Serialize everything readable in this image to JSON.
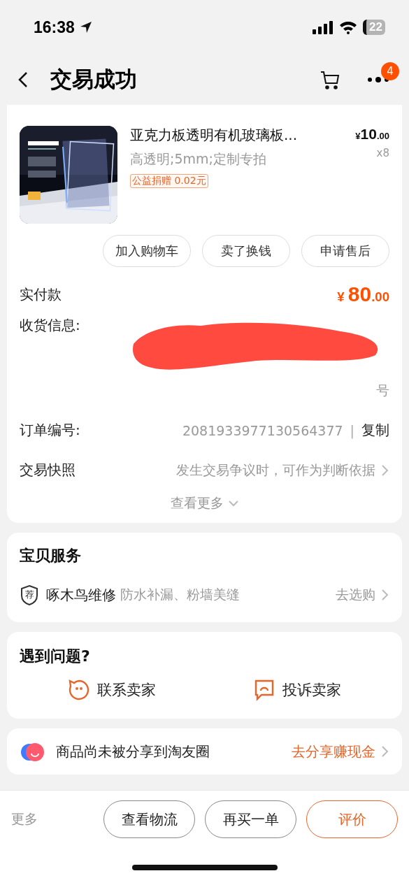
{
  "status_bar": {
    "time": "16:38",
    "battery": "22"
  },
  "header": {
    "title": "交易成功",
    "badge": "4"
  },
  "product": {
    "title": "亚克力板透明有机玻璃板...",
    "spec": "高透明;5mm;定制专拍",
    "tag": "公益捐赠 0.02元",
    "price_symbol": "¥",
    "price_int": "10",
    "price_dec": ".00",
    "qty": "x8"
  },
  "product_actions": [
    "加入购物车",
    "卖了换钱",
    "申请售后"
  ],
  "payment": {
    "label": "实付款",
    "symbol": "¥",
    "int": "80",
    "dec": ".00"
  },
  "address": {
    "label": "收货信息:",
    "visible_tail": "号"
  },
  "order": {
    "label": "订单编号:",
    "number": "2081933977130564377",
    "separator": "|",
    "copy": "复制"
  },
  "snapshot": {
    "label": "交易快照",
    "hint": "发生交易争议时，可作为判断依据"
  },
  "more": "查看更多",
  "service": {
    "title": "宝贝服务",
    "badge": "荐",
    "name": "啄木鸟维修",
    "desc": "防水补漏、粉墙美缝",
    "action": "去选购"
  },
  "help": {
    "title": "遇到问题?",
    "actions": [
      {
        "kind": "chat",
        "label": "联系卖家"
      },
      {
        "kind": "complain",
        "label": "投诉卖家"
      }
    ]
  },
  "share": {
    "text": "商品尚未被分享到淘友圈",
    "action": "去分享赚现金"
  },
  "bottom_bar": {
    "more": "更多",
    "buttons": [
      {
        "label": "查看物流",
        "primary": false
      },
      {
        "label": "再买一单",
        "primary": false
      },
      {
        "label": "评价",
        "primary": true
      }
    ]
  }
}
